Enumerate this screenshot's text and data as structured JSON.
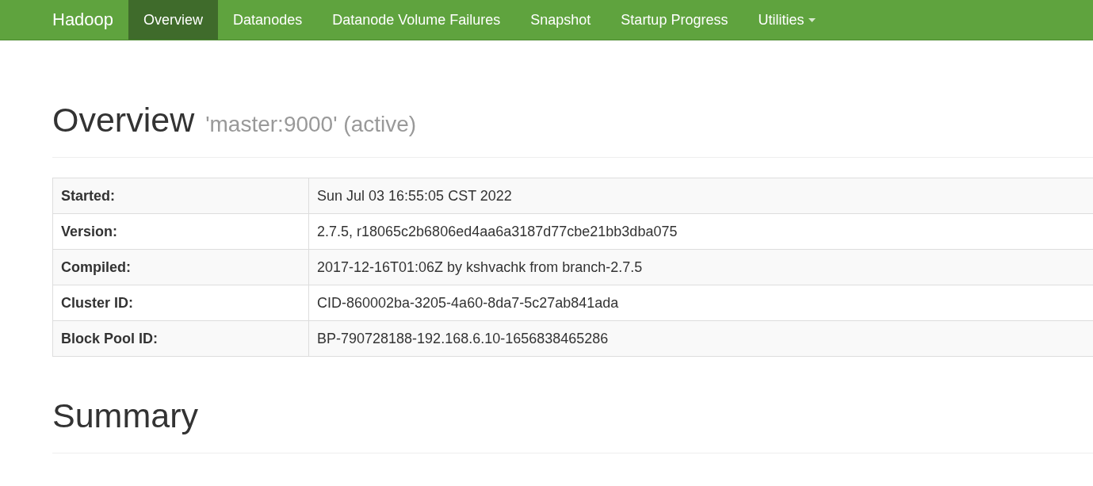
{
  "navbar": {
    "brand": "Hadoop",
    "items": [
      {
        "label": "Overview",
        "selected": true,
        "dropdown": false
      },
      {
        "label": "Datanodes",
        "selected": false,
        "dropdown": false
      },
      {
        "label": "Datanode Volume Failures",
        "selected": false,
        "dropdown": false
      },
      {
        "label": "Snapshot",
        "selected": false,
        "dropdown": false
      },
      {
        "label": "Startup Progress",
        "selected": false,
        "dropdown": false
      },
      {
        "label": "Utilities",
        "selected": false,
        "dropdown": true
      }
    ]
  },
  "header": {
    "title": "Overview",
    "subtitle": "'master:9000' (active)"
  },
  "info_table": {
    "rows": [
      {
        "label": "Started:",
        "value": "Sun Jul 03 16:55:05 CST 2022"
      },
      {
        "label": "Version:",
        "value": "2.7.5, r18065c2b6806ed4aa6a3187d77cbe21bb3dba075"
      },
      {
        "label": "Compiled:",
        "value": "2017-12-16T01:06Z by kshvachk from branch-2.7.5"
      },
      {
        "label": "Cluster ID:",
        "value": "CID-860002ba-3205-4a60-8da7-5c27ab841ada"
      },
      {
        "label": "Block Pool ID:",
        "value": "BP-790728188-192.168.6.10-1656838465286"
      }
    ]
  },
  "summary": {
    "title": "Summary"
  }
}
